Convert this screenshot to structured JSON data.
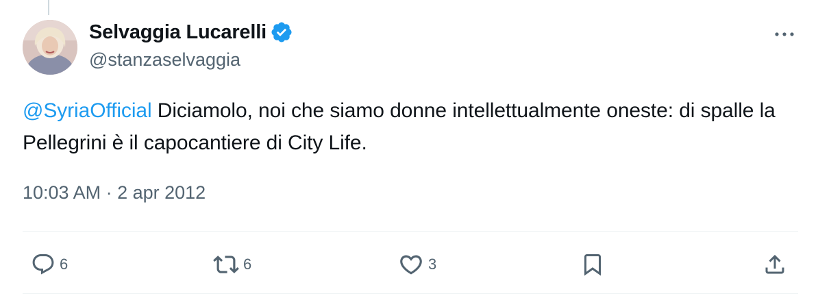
{
  "tweet": {
    "author": {
      "display_name": "Selvaggia Lucarelli",
      "handle": "@stanzaselvaggia",
      "verified_icon": "verified-badge-icon",
      "avatar_icon": "avatar-photo"
    },
    "text": {
      "mention": "@SyriaOfficial",
      "body": " Diciamolo, noi che siamo donne intellettualmente oneste: di spalle la Pellegrini è il capocantiere di City Life."
    },
    "timestamp": {
      "time": "10:03 AM",
      "separator": " · ",
      "date": "2 apr 2012"
    },
    "actions": {
      "replies": "6",
      "reposts": "6",
      "likes": "3"
    }
  },
  "colors": {
    "accent": "#1d9bf0",
    "text_primary": "#0f1419",
    "text_secondary": "#536471",
    "divider": "#eff3f4"
  }
}
